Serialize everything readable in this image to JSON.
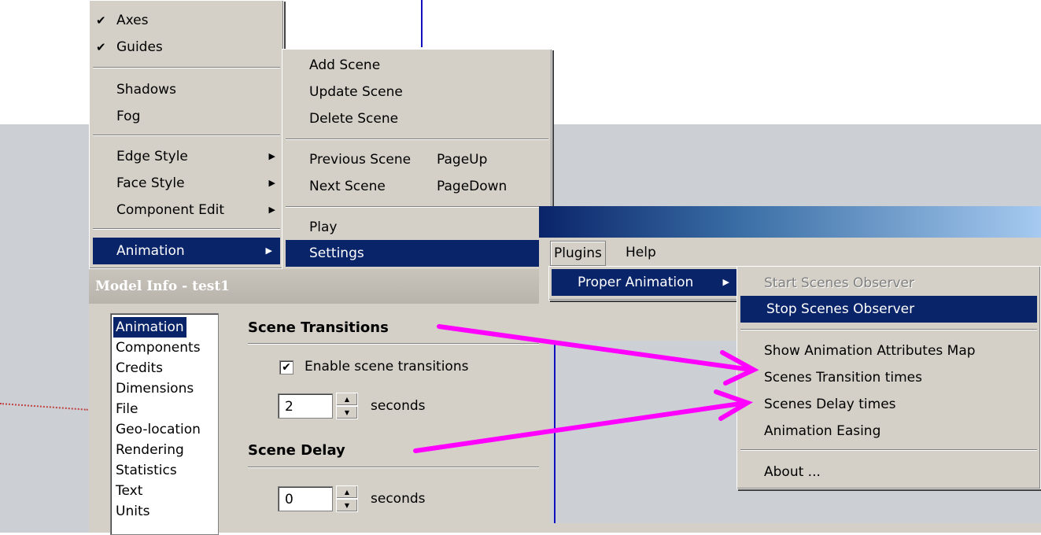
{
  "view_menu": {
    "items": [
      {
        "label": "Axes",
        "checked": true
      },
      {
        "label": "Guides",
        "checked": true
      },
      {
        "label": "Shadows"
      },
      {
        "label": "Fog"
      },
      {
        "label": "Edge Style",
        "submenu": true
      },
      {
        "label": "Face Style",
        "submenu": true
      },
      {
        "label": "Component Edit",
        "submenu": true
      },
      {
        "label": "Animation",
        "submenu": true,
        "highlighted": true
      }
    ]
  },
  "animation_menu": {
    "add": "Add Scene",
    "update": "Update Scene",
    "delete": "Delete Scene",
    "previous": "Previous Scene",
    "previous_shortcut": "PageUp",
    "next": "Next Scene",
    "next_shortcut": "PageDown",
    "play": "Play",
    "settings": "Settings"
  },
  "model_info": {
    "title": "Model Info - test1",
    "list": [
      "Animation",
      "Components",
      "Credits",
      "Dimensions",
      "File",
      "Geo-location",
      "Rendering",
      "Statistics",
      "Text",
      "Units"
    ],
    "selected": "Animation",
    "scene_transitions_header": "Scene Transitions",
    "enable_label": "Enable scene transitions",
    "enable_checked": true,
    "transition_value": "2",
    "seconds_label": "seconds",
    "scene_delay_header": "Scene Delay",
    "delay_value": "0",
    "seconds_label2": "seconds"
  },
  "menubar": {
    "plugins": "Plugins",
    "help": "Help"
  },
  "plugins_menu": {
    "proper_animation": "Proper Animation"
  },
  "proper_animation_menu": {
    "start": "Start Scenes Observer",
    "stop": "Stop Scenes Observer",
    "show_map": "Show Animation Attributes Map",
    "transition_times": "Scenes Transition times",
    "delay_times": "Scenes Delay times",
    "easing": "Animation Easing",
    "about": "About ..."
  },
  "colors": {
    "highlight": "#0a246a",
    "face": "#d4d0c8",
    "arrow": "#ff00ff"
  }
}
